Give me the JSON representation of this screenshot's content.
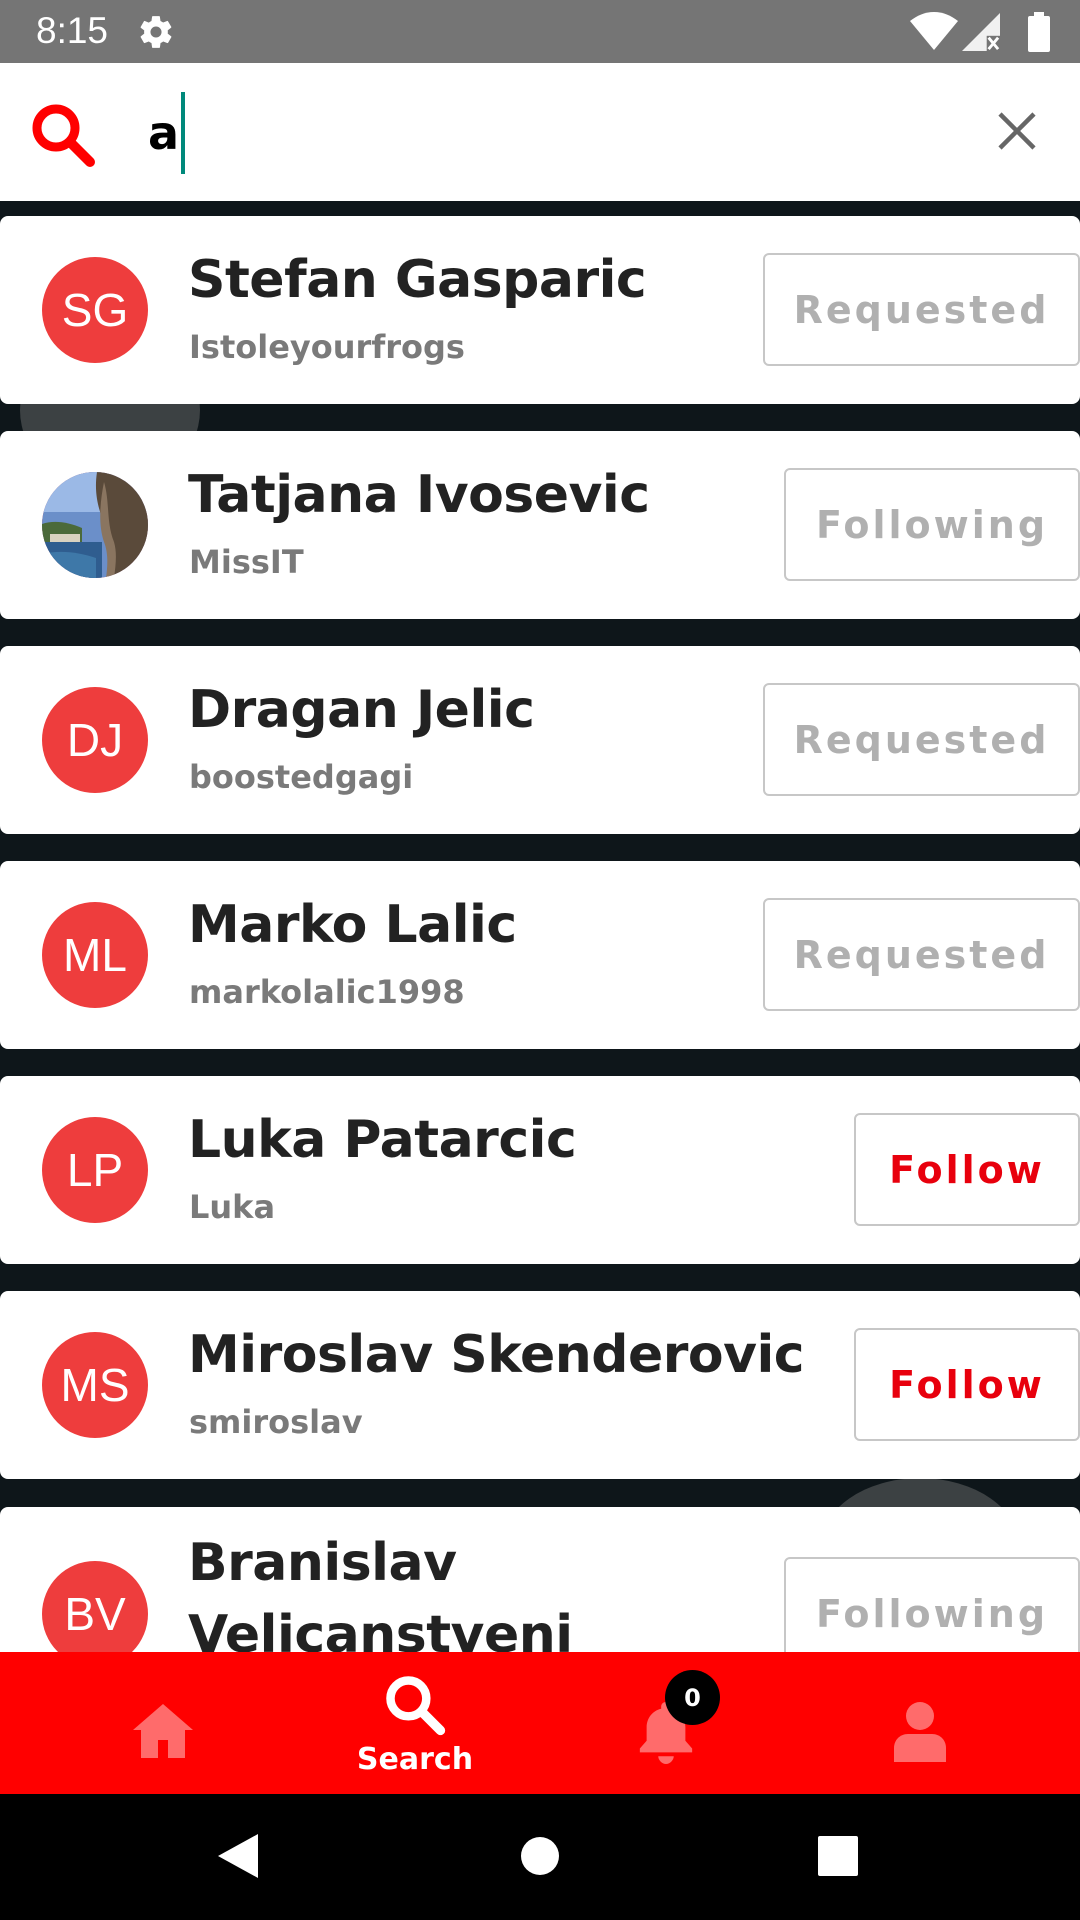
{
  "status_bar": {
    "time": "8:15"
  },
  "search": {
    "query": "a"
  },
  "results": [
    {
      "initials": "SG",
      "name": "Stefan Gasparic",
      "username": "Istoleyourfrogs",
      "button": "Requested",
      "state": "requested"
    },
    {
      "initials": "",
      "name": "Tatjana Ivosevic",
      "username": "MissIT",
      "button": "Following",
      "state": "following",
      "avatar_type": "photo"
    },
    {
      "initials": "DJ",
      "name": "Dragan Jelic",
      "username": "boostedgagi",
      "button": "Requested",
      "state": "requested"
    },
    {
      "initials": "ML",
      "name": "Marko Lalic",
      "username": "markolalic1998",
      "button": "Requested",
      "state": "requested"
    },
    {
      "initials": "LP",
      "name": "Luka Patarcic",
      "username": "Luka",
      "button": "Follow",
      "state": "follow"
    },
    {
      "initials": "MS",
      "name": "Miroslav Skenderovic",
      "username": "smiroslav",
      "button": "Follow",
      "state": "follow"
    },
    {
      "initials": "BV",
      "name": "Branislav Velicanstveni",
      "username": "",
      "button": "Following",
      "state": "following"
    }
  ],
  "bottom_nav": {
    "search_label": "Search",
    "notification_count": "0"
  },
  "colors": {
    "accent": "#ff0000",
    "avatar_bg": "#ee3d3d",
    "follow_text": "#e8000d",
    "muted_text": "#b0b0b0"
  },
  "icons": [
    "settings-icon",
    "wifi-icon",
    "signal-icon",
    "battery-icon",
    "search-icon",
    "close-icon",
    "home-icon",
    "bell-icon",
    "user-icon",
    "back-icon",
    "home-circle-icon",
    "recents-icon"
  ]
}
